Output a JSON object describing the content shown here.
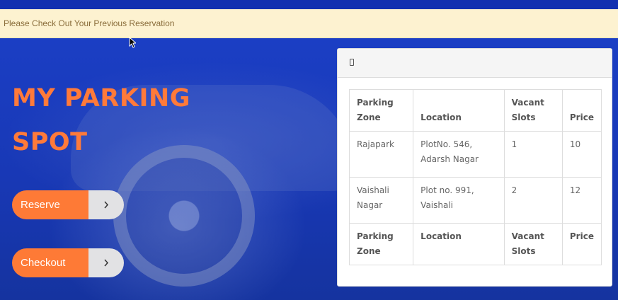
{
  "alert": {
    "text": "Please Check Out Your Previous Reservation"
  },
  "hero": {
    "title_line1": "MY PARKING",
    "title_line2": "SPOT",
    "accent_color": "#ff7a3a",
    "background_color": "#1a3fc4"
  },
  "buttons": {
    "reserve_label": "Reserve",
    "checkout_label": "Checkout",
    "arrow_icon": "chevron-right-icon"
  },
  "panel": {
    "header_icon": "panel-icon",
    "table": {
      "headers": [
        "Parking Zone",
        "Location",
        "Vacant Slots",
        "Price"
      ],
      "rows": [
        [
          "Rajapark",
          "PlotNo. 546, Adarsh Nagar",
          "1",
          "10"
        ],
        [
          "Vaishali Nagar",
          "Plot no. 991, Vaishali",
          "2",
          "12"
        ]
      ],
      "footers": [
        "Parking Zone",
        "Location",
        "Vacant Slots",
        "Price"
      ]
    }
  }
}
